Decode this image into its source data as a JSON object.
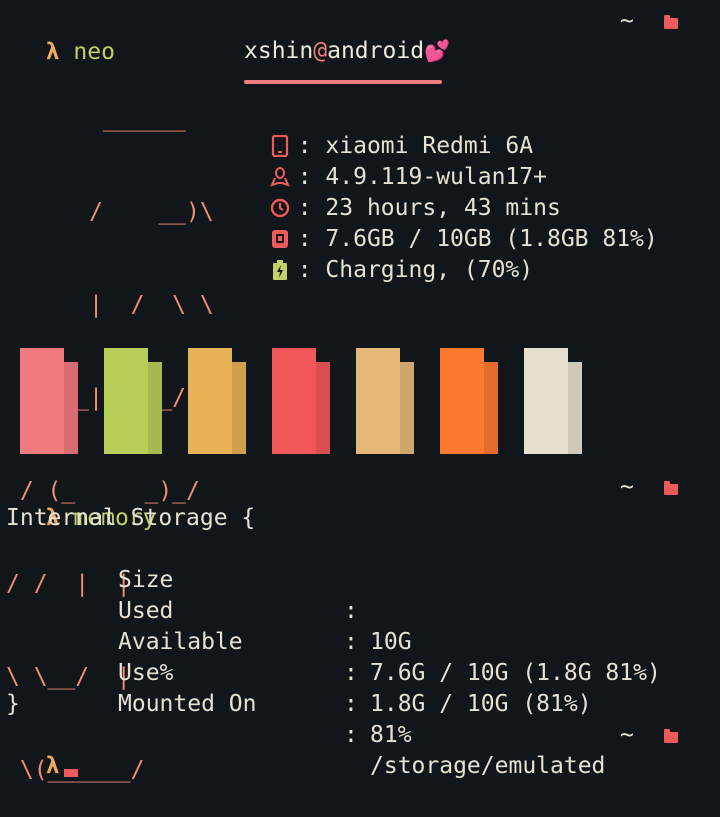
{
  "prompts": [
    {
      "symbol": "λ",
      "command": "neo",
      "path": "~"
    },
    {
      "symbol": "λ",
      "command": "memory",
      "path": "~"
    },
    {
      "symbol": "λ",
      "command": "",
      "path": "~"
    }
  ],
  "ascii_logo": [
    "       ______",
    "      /    __)\\",
    "      |  /  \\ \\",
    "   ___|  |__/ /",
    " / (_     _)_/",
    "/ /  |  |",
    "\\ \\__/  |",
    " \\(______/"
  ],
  "neofetch": {
    "user": "xshin",
    "at": "@",
    "host": "android",
    "heart": "💕",
    "rows": [
      {
        "icon": "phone-icon",
        "sep": ":",
        "value": "xiaomi Redmi 6A"
      },
      {
        "icon": "linux-icon",
        "sep": ":",
        "value": "4.9.119-wulan17+"
      },
      {
        "icon": "clock-icon",
        "sep": ":",
        "value": "23 hours, 43 mins"
      },
      {
        "icon": "memory-icon",
        "sep": ":",
        "value": "7.6GB / 10GB (1.8GB 81%)"
      },
      {
        "icon": "battery-icon",
        "sep": ":",
        "value": "Charging, (70%)"
      }
    ]
  },
  "palette": [
    "#f07a7e",
    "#b7cf58",
    "#e8b256",
    "#f2585a",
    "#e6b877",
    "#fb7a30",
    "#e6e0d0"
  ],
  "memory": {
    "open": "Internal Storage {",
    "rows": [
      {
        "key": "Size",
        "sep": ":",
        "value": "10G"
      },
      {
        "key": "Used",
        "sep": ":",
        "value": "7.6G / 10G (1.8G 81%)"
      },
      {
        "key": "Available",
        "sep": ":",
        "value": "1.8G / 10G (81%)"
      },
      {
        "key": "Use%",
        "sep": ":",
        "value": "81%"
      },
      {
        "key": "Mounted On",
        "sep": ":",
        "value": "/storage/emulated"
      }
    ],
    "close": "}"
  },
  "colors": {
    "background": "#11161b",
    "accent": "#f0a85d",
    "command": "#c3d067",
    "folder": "#ef5a5a"
  }
}
